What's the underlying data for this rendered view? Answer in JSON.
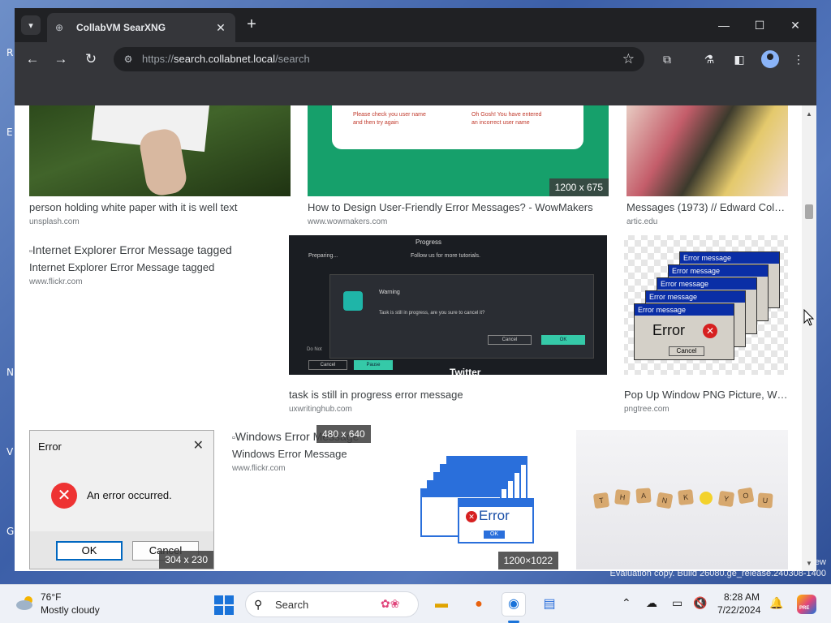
{
  "desktop": {
    "letters": [
      "R",
      "E",
      "N",
      "V",
      "G"
    ],
    "watermark": [
      "ew",
      "Evaluation copy. Build 26080.ge_release.240308-1400"
    ]
  },
  "browser": {
    "tab_title": "CollabVM SearXNG",
    "url_scheme": "https://",
    "url_host": "search.collabnet.local",
    "url_path": "/search"
  },
  "results": [
    {
      "title": "person holding white paper with it is well text",
      "source": "unsplash.com"
    },
    {
      "title": "How to Design User-Friendly Error Messages? - WowMakers",
      "source": "www.wowmakers.com",
      "badge": "1200 x 675",
      "thumb_text": [
        "Please check you user name",
        "and then try again",
        "Oh Gosh! You have entered",
        "an incorrect user name"
      ]
    },
    {
      "title": "Messages (1973) // Edward Col…",
      "source": "artic.edu"
    },
    {
      "title": "Internet Explorer Error Message tagged",
      "alt": "Internet Explorer Error Message tagged",
      "source": "www.flickr.com"
    },
    {
      "title": "task is still in progress error message",
      "source": "uxwritinghub.com",
      "thumb_text": {
        "top": "Progress",
        "preparing": "Preparing...",
        "follow": "Follow us for more tutorials.",
        "warning": "Warning",
        "message": "Task is still in progress, are you sure to cancel it?",
        "cancel": "Cancel",
        "ok": "OK",
        "cancel2": "Cancel",
        "pause": "Pause",
        "twitter": "Twitter",
        "donot": "Do Not"
      }
    },
    {
      "title": "Pop Up Window PNG Picture, W…",
      "source": "pngtree.com",
      "thumb_text": {
        "bar": "Error message",
        "error": "Error",
        "cancel": "Cancel"
      }
    },
    {
      "badge": "304 x 230",
      "thumb_text": {
        "title": "Error",
        "message": "An error occurred.",
        "ok": "OK",
        "cancel": "Cancel"
      }
    },
    {
      "title": "Windows Error Message",
      "alt": "Windows Error Message",
      "source": "www.flickr.com",
      "badge": "480 x 640"
    },
    {
      "badge": "1200×1022",
      "thumb_text": {
        "error": "Error",
        "ok": "OK"
      }
    },
    {
      "thumb_text": [
        "T",
        "H",
        "A",
        "N",
        "K",
        "Y",
        "O",
        "U"
      ]
    }
  ],
  "taskbar": {
    "weather_temp": "76°F",
    "weather_desc": "Mostly cloudy",
    "search_label": "Search",
    "clock_time": "8:28 AM",
    "clock_date": "7/22/2024",
    "copilot_badge": "PRE"
  }
}
